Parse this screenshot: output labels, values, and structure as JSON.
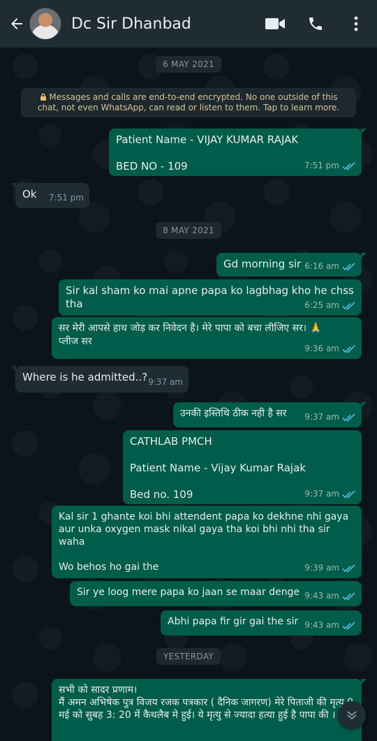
{
  "header": {
    "contact_name": "Dc Sir Dhanbad"
  },
  "chat": {
    "dates": [
      "6 MAY 2021",
      "8 MAY 2021",
      "YESTERDAY"
    ],
    "encryption_notice": "Messages and calls are end-to-end encrypted. No one outside of this chat, not even WhatsApp, can read or listen to them. Tap to learn more.",
    "messages": [
      {
        "dir": "out",
        "text": "Patient Name - VIJAY KUMAR RAJAK\n\nBED NO - 109",
        "time": "7:51 pm"
      },
      {
        "dir": "in",
        "text": "Ok",
        "time": "7:51 pm"
      },
      {
        "dir": "out",
        "text": "Gd morning sir",
        "time": "6:16 am"
      },
      {
        "dir": "out",
        "text": "Sir kal sham ko  mai apne papa ko lagbhag kho he chss tha",
        "time": "6:25 am"
      },
      {
        "dir": "out",
        "text": "सर मेरी आपसे हाथ जोड़ कर निवेदन है। मेरे पापा को बचा लीजिए सर। 🙏\nप्लीज सर",
        "time": "9:36 am"
      },
      {
        "dir": "in",
        "text": "Where is he admitted..?",
        "time": "9:37 am"
      },
      {
        "dir": "out",
        "text": "उनकी इस्तिथि ठीक नही है सर",
        "time": "9:37 am"
      },
      {
        "dir": "out",
        "text": "CATHLAB PMCH\n\nPatient Name - Vijay Kumar Rajak\n\nBed no. 109",
        "time": "9:37 am"
      },
      {
        "dir": "out",
        "text": "Kal sir 1 ghante koi bhi attendent papa ko dekhne nhi gaya aur unka oxygen mask nikal gaya tha koi bhi nhi tha sir waha\n\nWo behos ho gai the",
        "time": "9:39 am"
      },
      {
        "dir": "out",
        "text": "Sir ye loog mere papa ko jaan se maar denge",
        "time": "9:43 am"
      },
      {
        "dir": "out",
        "text": "Abhi papa fir gir gai the sir",
        "time": "9:43 am"
      },
      {
        "dir": "out",
        "text": "सभी को सादर प्रणाम।\nमैं अमन अभिषेक पुत्र विजय रजक पत्रकार ( दैनिक जागरण) मेरे पिताजी की मृत्यु 9 मई को सुबह 3: 20 में कैथलैब मे हुई। ये मृत्यु से ज्यादा हत्या हुई है पापा की ।",
        "time": ""
      }
    ]
  },
  "colors": {
    "header_bg": "#1f2c34",
    "chat_bg": "#0b141a",
    "outgoing_bubble": "#005c4b",
    "incoming_bubble": "#1f2c34",
    "read_tick": "#53bdeb"
  },
  "icons": [
    "back-arrow-icon",
    "video-call-icon",
    "voice-call-icon",
    "more-options-icon",
    "lock-icon",
    "double-check-icon",
    "scroll-down-icon"
  ]
}
